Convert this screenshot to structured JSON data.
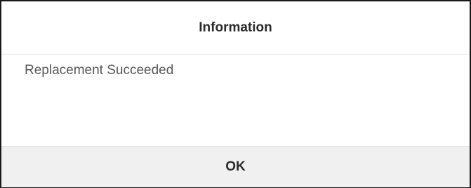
{
  "dialog": {
    "title": "Information",
    "message": "Replacement Succeeded",
    "ok_label": "OK"
  },
  "colors": {
    "border": "#1a1a1a",
    "footer_background": "#f0f0f0",
    "title_text": "#2b2b2b",
    "message_text": "#595959"
  }
}
